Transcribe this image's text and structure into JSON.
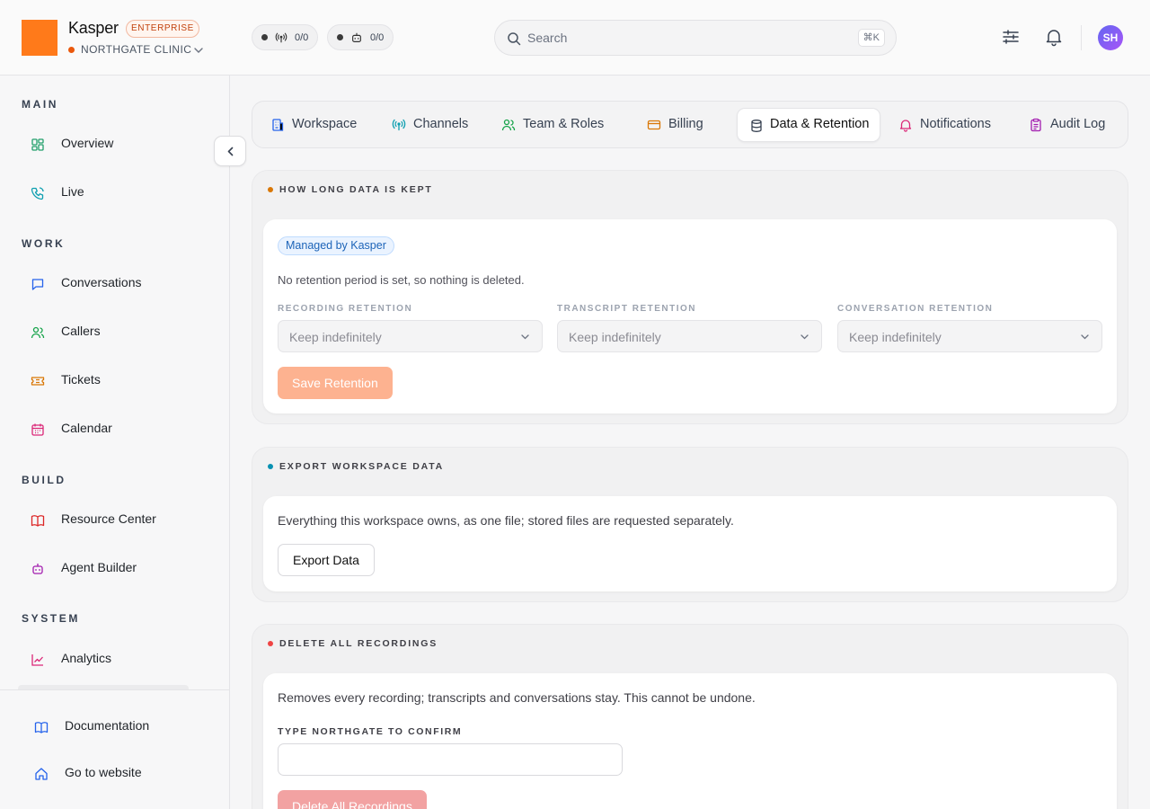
{
  "brand": {
    "name": "Kasper",
    "badge": "ENTERPRISE",
    "org": "NORTHGATE CLINIC"
  },
  "status_pills": [
    {
      "icon": "broadcast-icon",
      "value": "0/0"
    },
    {
      "icon": "robot-icon",
      "value": "0/0"
    }
  ],
  "search": {
    "placeholder": "Search",
    "shortcut": "⌘K"
  },
  "user": {
    "initials": "SH"
  },
  "sidebar": {
    "sections": [
      {
        "title": "MAIN",
        "items": [
          {
            "label": "Overview",
            "icon": "grid-icon"
          },
          {
            "label": "Live",
            "icon": "phone-icon"
          }
        ]
      },
      {
        "title": "WORK",
        "items": [
          {
            "label": "Conversations",
            "icon": "chat-icon"
          },
          {
            "label": "Callers",
            "icon": "users-icon"
          },
          {
            "label": "Tickets",
            "icon": "ticket-icon"
          },
          {
            "label": "Calendar",
            "icon": "calendar-icon"
          }
        ]
      },
      {
        "title": "BUILD",
        "items": [
          {
            "label": "Resource Center",
            "icon": "book-icon"
          },
          {
            "label": "Agent Builder",
            "icon": "robot-icon"
          }
        ]
      },
      {
        "title": "SYSTEM",
        "items": [
          {
            "label": "Analytics",
            "icon": "chart-icon"
          }
        ]
      }
    ],
    "footer": [
      {
        "label": "Documentation",
        "icon": "book-open-icon"
      },
      {
        "label": "Go to website",
        "icon": "home-icon"
      }
    ]
  },
  "tabs": [
    {
      "label": "Workspace",
      "icon": "building-icon"
    },
    {
      "label": "Channels",
      "icon": "broadcast-icon"
    },
    {
      "label": "Team & Roles",
      "icon": "users-icon"
    },
    {
      "label": "Billing",
      "icon": "credit-card-icon"
    },
    {
      "label": "Data & Retention",
      "icon": "database-icon",
      "active": true
    },
    {
      "label": "Notifications",
      "icon": "bell-icon"
    },
    {
      "label": "Audit Log",
      "icon": "clipboard-icon"
    }
  ],
  "retention": {
    "title": "HOW LONG DATA IS KEPT",
    "badge": "Managed by Kasper",
    "note": "No retention period is set, so nothing is deleted.",
    "fields": [
      {
        "label": "RECORDING RETENTION",
        "value": "Keep indefinitely"
      },
      {
        "label": "TRANSCRIPT RETENTION",
        "value": "Keep indefinitely"
      },
      {
        "label": "CONVERSATION RETENTION",
        "value": "Keep indefinitely"
      }
    ],
    "save_label": "Save Retention"
  },
  "export": {
    "title": "EXPORT WORKSPACE DATA",
    "description": "Everything this workspace owns, as one file; stored files are requested separately.",
    "button_label": "Export Data"
  },
  "delete": {
    "title": "DELETE ALL RECORDINGS",
    "description": "Removes every recording; transcripts and conversations stay. This cannot be undone.",
    "confirm_label": "TYPE NORTHGATE TO CONFIRM",
    "confirm_value": "",
    "button_label": "Delete All Recordings"
  },
  "colors": {
    "brand": "#ff7a1a",
    "retention_dot": "#d97706",
    "export_dot": "#0891b2",
    "delete_dot": "#ef4444"
  }
}
